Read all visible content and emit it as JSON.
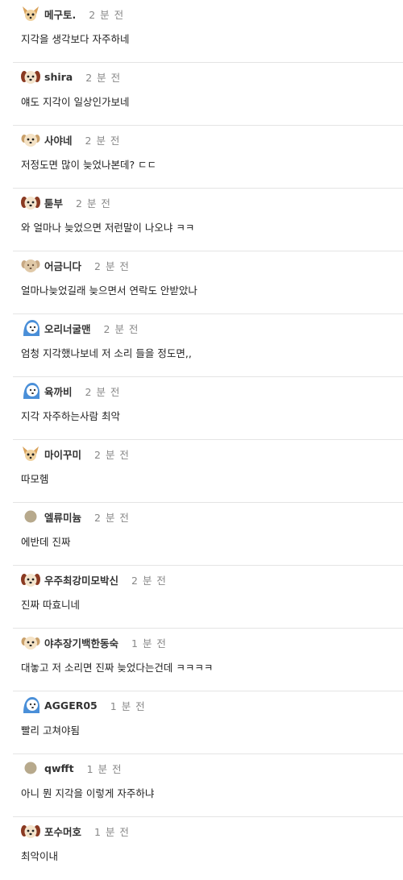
{
  "comments": [
    {
      "avatar": "chihuahua-icon",
      "nickname": "메구토.",
      "time": "2 분 전",
      "text": "지각을 생각보다 자주하네"
    },
    {
      "avatar": "dog-brown-ears-icon",
      "nickname": "shira",
      "time": "2 분 전",
      "text": "얘도 지각이 일상인가보네"
    },
    {
      "avatar": "puppy-icon",
      "nickname": "사야네",
      "time": "2 분 전",
      "text": "저정도면 많이 늦었나본데? ㄷㄷ"
    },
    {
      "avatar": "dog-brown-ears-icon",
      "nickname": "툳부",
      "time": "2 분 전",
      "text": "와 얼마나 늦었으면 저런말이 나오냐 ㅋㅋ"
    },
    {
      "avatar": "puppy-beige-icon",
      "nickname": "어금니다",
      "time": "2 분 전",
      "text": "얼마나늦었길래 늦으면서 연락도 안받았나"
    },
    {
      "avatar": "blue-creature-icon",
      "nickname": "오리너굴맨",
      "time": "2 분 전",
      "text": "엄청 지각했나보네 저 소리 들을 정도면,,"
    },
    {
      "avatar": "blue-creature-icon",
      "nickname": "육까비",
      "time": "2 분 전",
      "text": "지각 자주하는사람 최악"
    },
    {
      "avatar": "chihuahua-icon",
      "nickname": "마이꾸미",
      "time": "2 분 전",
      "text": "따모헴"
    },
    {
      "avatar": "default-circle-icon",
      "nickname": "엘류미늄",
      "time": "2 분 전",
      "text": "에반데 진짜"
    },
    {
      "avatar": "dog-brown-ears-icon",
      "nickname": "우주최강미모박신",
      "time": "2 분 전",
      "text": "진짜 따효니네"
    },
    {
      "avatar": "puppy-icon",
      "nickname": "야추장기백한동숙",
      "time": "1 분 전",
      "text": "대놓고 저 소리면 진짜 늦었다는건데 ㅋㅋㅋㅋ"
    },
    {
      "avatar": "blue-creature-icon",
      "nickname": "AGGER05",
      "time": "1 분 전",
      "text": "빨리 고쳐야됨"
    },
    {
      "avatar": "default-circle-icon",
      "nickname": "qwfft",
      "time": "1 분 전",
      "text": "아니 뭔 지각을 이렇게 자주하냐"
    },
    {
      "avatar": "dog-brown-ears-icon",
      "nickname": "포수머호",
      "time": "1 분 전",
      "text": "최악이내"
    }
  ]
}
